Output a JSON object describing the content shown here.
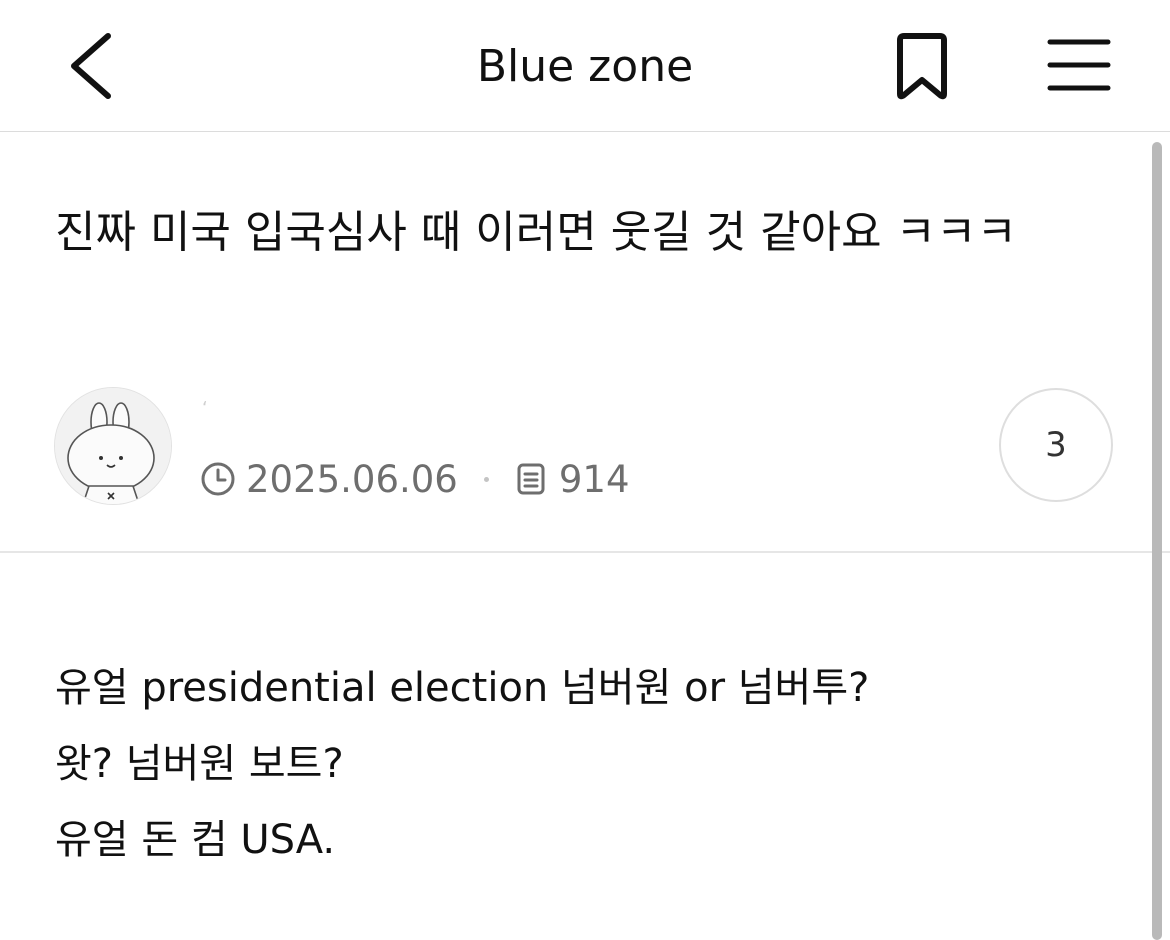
{
  "header": {
    "title": "Blue zone",
    "back_icon": "chevron-left-icon",
    "bookmark_icon": "bookmark-icon",
    "menu_icon": "hamburger-menu-icon"
  },
  "post": {
    "title": "진짜 미국 입국심사 때 이러면 웃길 것 같아요 ㅋㅋㅋ",
    "author": {
      "name": "‘",
      "avatar_icon": "bunny-avatar-icon"
    },
    "date": "2025.06.06",
    "views": "914",
    "comment_count": "3",
    "body_lines": [
      "유얼 presidential election 넘버원 or 넘버투?",
      "왓? 넘버원 보트?",
      "유얼 돈 컴 USA."
    ]
  },
  "colors": {
    "text": "#111111",
    "meta": "#6e6e6e",
    "divider": "#e6e6e6",
    "scrollbar": "#b9b9b9"
  }
}
